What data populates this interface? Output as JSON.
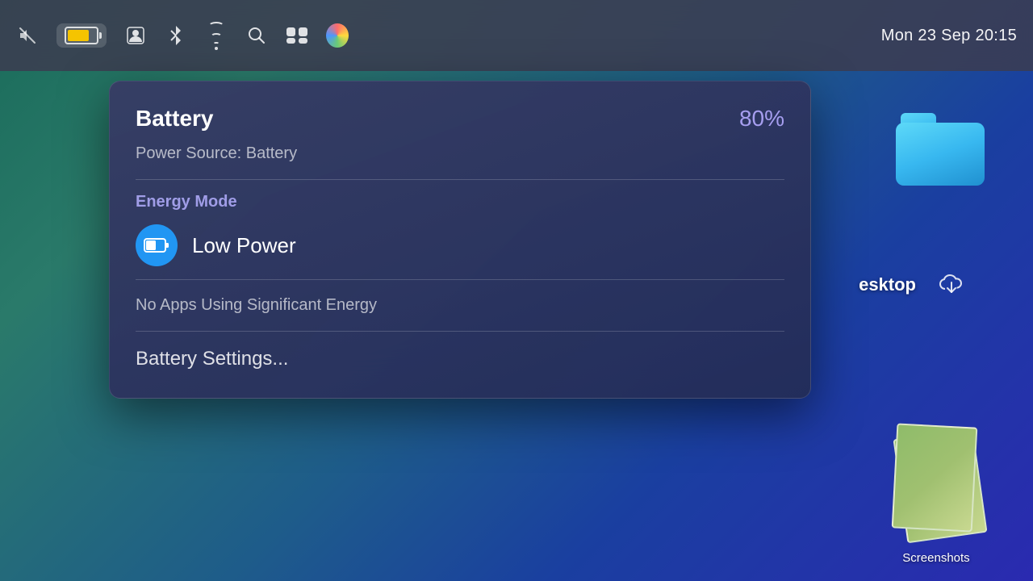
{
  "menubar": {
    "datetime": "Mon 23 Sep  20:15"
  },
  "battery_dropdown": {
    "title": "Battery",
    "percent": "80%",
    "power_source": "Power Source: Battery",
    "energy_mode_label": "Energy Mode",
    "low_power_text": "Low Power",
    "no_apps_text": "No Apps Using Significant Energy",
    "settings_text": "Battery Settings..."
  },
  "desktop": {
    "folder_label": "",
    "desktop_label": "esktop",
    "screenshots_label": "Screenshots"
  }
}
